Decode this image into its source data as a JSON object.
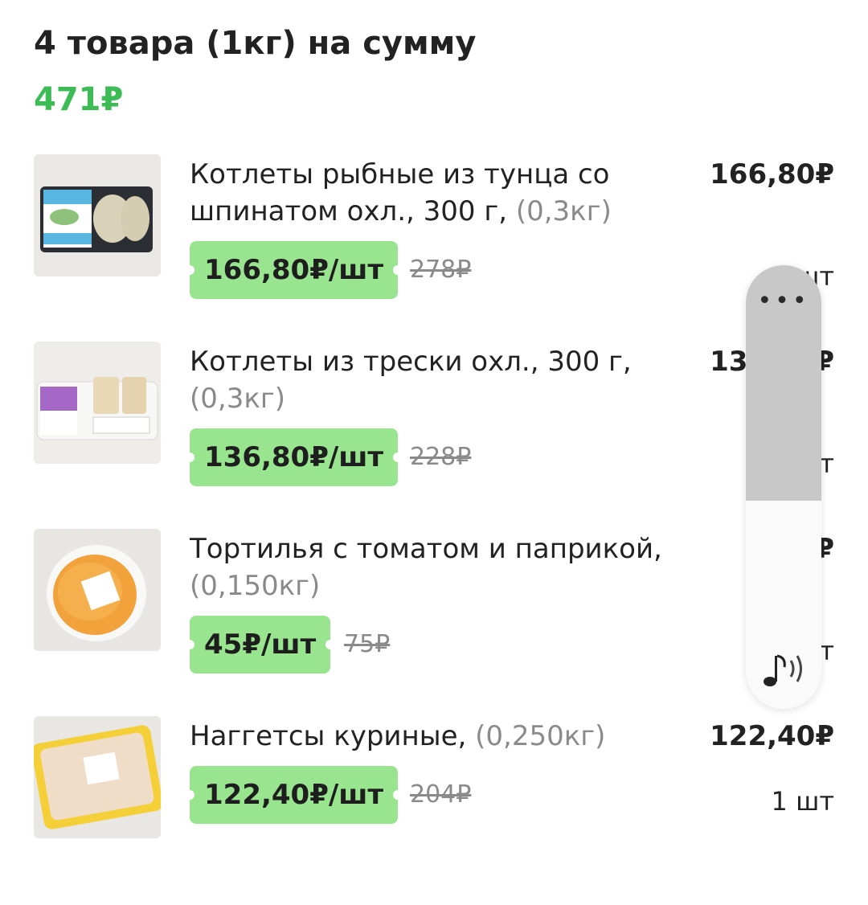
{
  "summary": {
    "title": "4 товара (1кг) на сумму",
    "total": "471₽"
  },
  "items": [
    {
      "name": "Котлеты рыбные из тунца со шпинатом охл., 300 г,",
      "weight": "(0,3кг)",
      "unit_price": "166,80₽/шт",
      "old_price": "278₽",
      "sum": "166,80₽",
      "qty": "1 шт",
      "image_icon": "fish-cutlets-package-icon"
    },
    {
      "name": "Котлеты из трески охл., 300 г,",
      "weight": "(0,3кг)",
      "unit_price": "136,80₽/шт",
      "old_price": "228₽",
      "sum": "136,80₽",
      "qty": "1 шт",
      "image_icon": "cod-cutlets-package-icon"
    },
    {
      "name": "Тортилья с томатом и паприкой,",
      "weight": "(0,150кг)",
      "unit_price": "45₽/шт",
      "old_price": "75₽",
      "sum": "45₽",
      "qty": "1 шт",
      "image_icon": "tortilla-package-icon"
    },
    {
      "name": "Наггетсы куриные,",
      "weight": "(0,250кг)",
      "unit_price": "122,40₽/шт",
      "old_price": "204₽",
      "sum": "122,40₽",
      "qty": "1 шт",
      "image_icon": "chicken-nuggets-package-icon"
    }
  ],
  "volume_overlay": {
    "menu_icon": "more-dots-icon",
    "media_icon": "music-note-icon",
    "level": 0.47
  },
  "colors": {
    "accent": "#3dbb55",
    "price_tag_bg": "#99e58f",
    "muted_text": "#8a8a8a"
  }
}
